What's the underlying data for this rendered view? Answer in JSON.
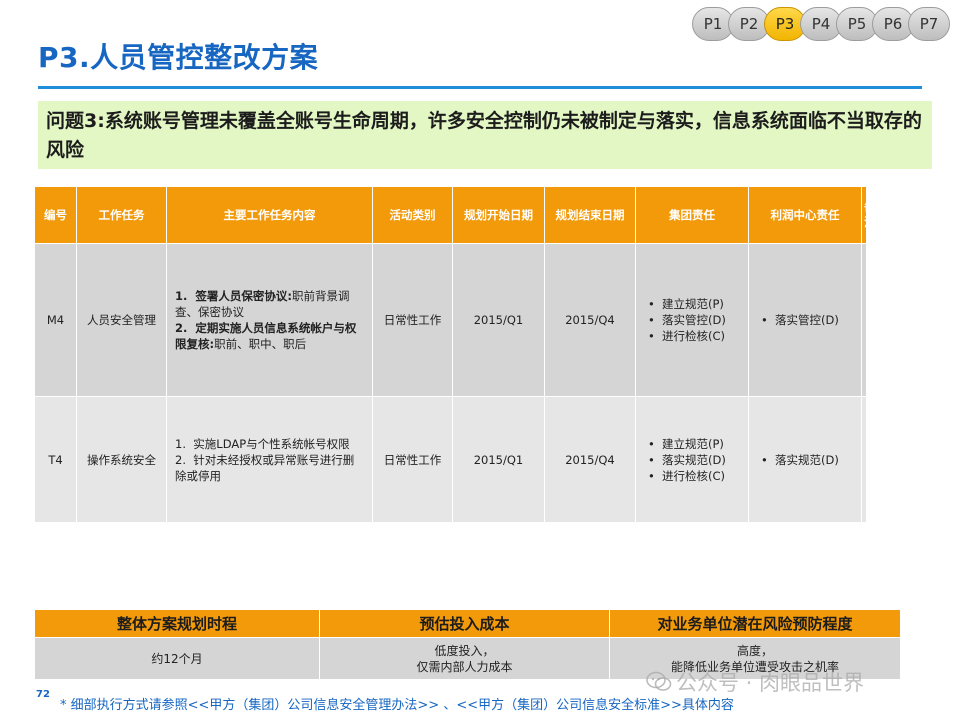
{
  "page_tabs": [
    "P1",
    "P2",
    "P3",
    "P4",
    "P5",
    "P6",
    "P7"
  ],
  "active_tab": "P3",
  "title": "P3.人员管控整改方案",
  "issue_text": "问题3:系统账号管理未覆盖全账号生命周期，许多安全控制仍未被制定与落实，信息系统面临不当取存的风险",
  "table": {
    "headers": [
      "编号",
      "工作任务",
      "主要工作任务内容",
      "活动类别",
      "规划开始日期",
      "规划结束日期",
      "集团责任",
      "利润中心责任",
      "备注"
    ],
    "rows": [
      {
        "id": "M4",
        "task": "人员安全管理",
        "content": [
          {
            "num": "1.",
            "title": "签署人员保密协议:",
            "text": "职前背景调查、保密协议"
          },
          {
            "num": "2.",
            "title": "定期实施人员信息系统帐户与权限复核:",
            "text": "职前、职中、职后"
          }
        ],
        "category": "日常性工作",
        "start": "2015/Q1",
        "end": "2015/Q4",
        "group_duty": [
          "建立规范(P)",
          "落实管控(D)",
          "进行检核(C)"
        ],
        "profit_duty": [
          "落实管控(D)"
        ],
        "note": ""
      },
      {
        "id": "T4",
        "task": "操作系统安全",
        "content": [
          {
            "num": "1.",
            "title": "",
            "text": "实施LDAP与个性系统帐号权限"
          },
          {
            "num": "2.",
            "title": "",
            "text": "针对未经授权或异常账号进行删除或停用"
          }
        ],
        "category": "日常性工作",
        "start": "2015/Q1",
        "end": "2015/Q4",
        "group_duty": [
          "建立规范(P)",
          "落实规范(D)",
          "进行检核(C)"
        ],
        "profit_duty": [
          "落实规范(D)"
        ],
        "note": ""
      }
    ]
  },
  "summary": {
    "headers": [
      "整体方案规划时程",
      "预估投入成本",
      "对业务单位潜在风险预防程度"
    ],
    "values": [
      [
        "约12个月"
      ],
      [
        "低度投入，",
        "仅需内部人力成本"
      ],
      [
        "高度，",
        "能降低业务单位遭受攻击之机率"
      ]
    ]
  },
  "page_number": "72",
  "footnote": "* 细部执行方式请参照<<甲方（集团）公司信息安全管理办法>> 、<<甲方（集团）公司信息安全标准>>具体内容",
  "watermark": "公众号 · 肉眼品世界",
  "colors": {
    "title_blue": "#1666c2",
    "header_orange": "#f39a0a",
    "issue_green": "#e3f7c5",
    "tab_active": "#f2b400"
  }
}
